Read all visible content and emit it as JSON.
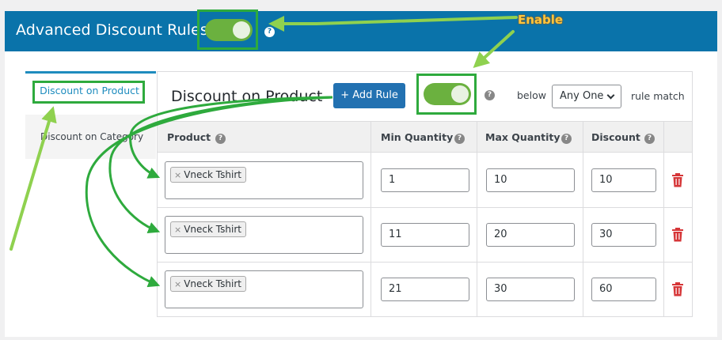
{
  "header": {
    "title": "Advanced Discount Rules",
    "enabled": true,
    "help": "?"
  },
  "annotation": {
    "enable_label": "Enable"
  },
  "sidebar": {
    "items": [
      {
        "label": "Discount on Product",
        "active": true
      },
      {
        "label": "Discount on Category",
        "active": false
      }
    ]
  },
  "main": {
    "title": "Discount on Product",
    "add_rule_label": "+ Add Rule",
    "enabled": true,
    "help": "?",
    "below_label": "below",
    "match_select": {
      "value": "Any One"
    },
    "rule_match_label": "rule match"
  },
  "table": {
    "columns": [
      {
        "label": "Product",
        "help": "?"
      },
      {
        "label": "Min Quantity",
        "help": "?"
      },
      {
        "label": "Max Quantity",
        "help": "?"
      },
      {
        "label": "Discount",
        "help": "?"
      }
    ],
    "rows": [
      {
        "product_tag": "Vneck Tshirt",
        "tag_remove": "×",
        "min": "1",
        "max": "10",
        "discount": "10"
      },
      {
        "product_tag": "Vneck Tshirt",
        "tag_remove": "×",
        "min": "11",
        "max": "20",
        "discount": "30"
      },
      {
        "product_tag": "Vneck Tshirt",
        "tag_remove": "×",
        "min": "21",
        "max": "30",
        "discount": "60"
      }
    ]
  },
  "colors": {
    "header_bg": "#0a73aa",
    "toggle_on": "#6bb13f",
    "highlight": "#2eaa3d",
    "primary_button": "#2271b1",
    "delete": "#d63638",
    "enable_label": "#ffc53d"
  },
  "icons": {
    "help": "question-circle-icon",
    "delete": "trash-icon",
    "select": "chevron-down-icon",
    "tag_remove": "close-icon"
  }
}
